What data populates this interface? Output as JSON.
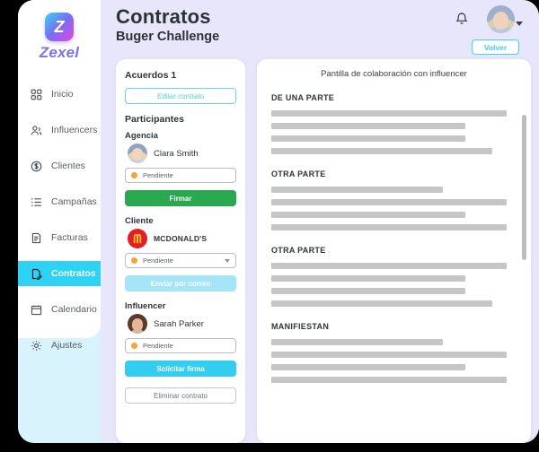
{
  "sidebar": {
    "logo": {
      "mark_letter": "Z",
      "word": "Zexel"
    },
    "items": [
      {
        "label": "Inicio",
        "icon": "grid-icon",
        "active": false
      },
      {
        "label": "Influencers",
        "icon": "people-icon",
        "active": false
      },
      {
        "label": "Clientes",
        "icon": "dollar-icon",
        "active": false
      },
      {
        "label": "Campañas",
        "icon": "list-icon",
        "active": false
      },
      {
        "label": "Facturas",
        "icon": "invoice-icon",
        "active": false
      },
      {
        "label": "Contratos",
        "icon": "contract-icon",
        "active": true
      },
      {
        "label": "Calendario",
        "icon": "calendar-icon",
        "active": false
      },
      {
        "label": "Ajustes",
        "icon": "gear-icon",
        "active": false
      }
    ]
  },
  "header": {
    "title": "Contratos",
    "subtitle": "Buger Challenge",
    "bell_icon": "bell-icon",
    "avatar_icon": "user-avatar",
    "back_label": "Volver"
  },
  "agreement_panel": {
    "title": "Acuerdos 1",
    "edit_label": "Editar contrato",
    "participants_label": "Participantes",
    "participants": [
      {
        "role": "Agencia",
        "name": "Clara Smith",
        "avatar": "woman-blonde-avatar",
        "status": "Pendiente",
        "status_color": "#f5a43a",
        "has_caret": false,
        "action_label": "Firmar",
        "action_style": "green"
      },
      {
        "role": "Cliente",
        "name": "MCDONALD'S",
        "avatar": "mcdonalds-logo",
        "status": "Pendiente",
        "status_color": "#f5a43a",
        "has_caret": true,
        "action_label": "Enviar por correo",
        "action_style": "cyan-soft"
      },
      {
        "role": "Influencer",
        "name": "Sarah Parker",
        "avatar": "woman-brunette-avatar",
        "status": "Pendiente",
        "status_color": "#f5a43a",
        "has_caret": false,
        "action_label": "Solicitar firma",
        "action_style": "cyan"
      }
    ],
    "delete_label": "Eliminar contrato"
  },
  "document_panel": {
    "title": "Pantilla de colaboración con influencer",
    "sections": [
      {
        "heading": "DE UNA PARTE",
        "line_widths": [
          96,
          79,
          79,
          90
        ]
      },
      {
        "heading": "OTRA PARTE",
        "line_widths": [
          70,
          96,
          79,
          96
        ]
      },
      {
        "heading": "OTRA PARTE",
        "line_widths": [
          96,
          79,
          79,
          90
        ]
      },
      {
        "heading": "MANIFIESTAN",
        "line_widths": [
          70,
          96,
          79,
          96
        ]
      }
    ],
    "scrollbar": "vertical-scrollbar"
  },
  "colors": {
    "accent_cyan": "#2ed2f2",
    "background_lavender": "#e7e6fb",
    "sidebar_cyan": "#d9f3fc",
    "success_green": "#2aa84f",
    "status_orange": "#f5a43a",
    "placeholder_gray": "#c6c6c6"
  }
}
